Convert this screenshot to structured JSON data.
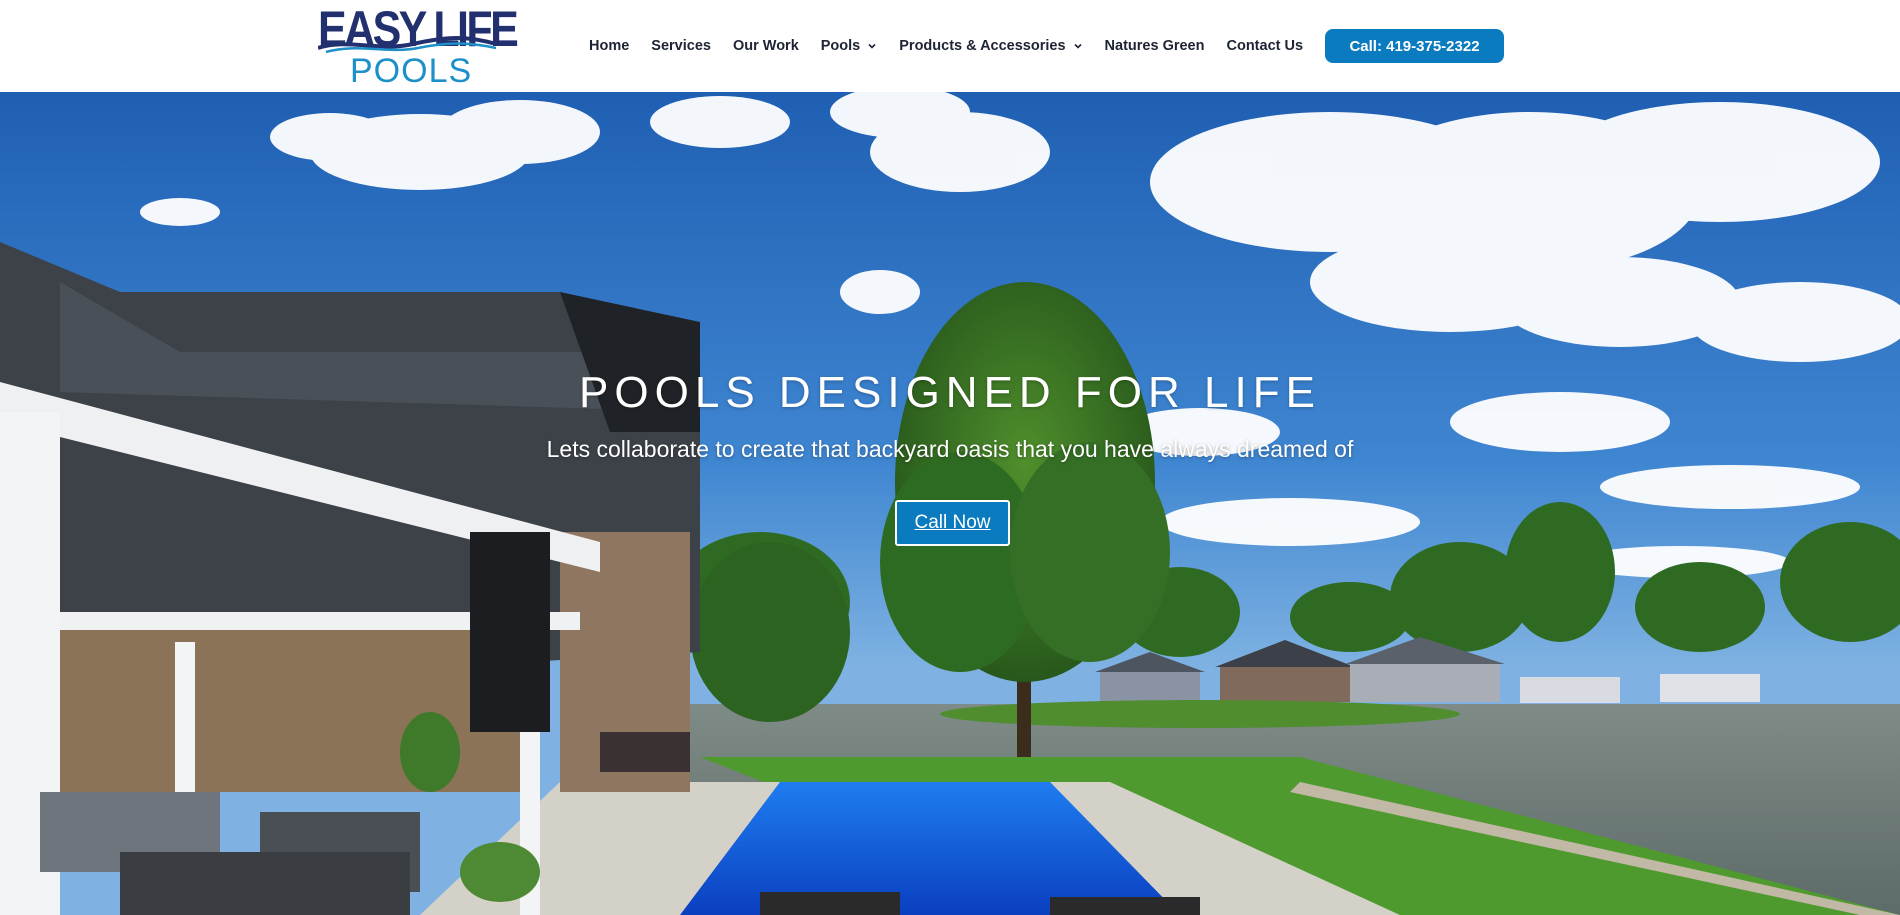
{
  "logo": {
    "line1": "EASY LIFE",
    "line2": "POOLS",
    "colors": {
      "primary": "#23306f",
      "secondary": "#1d8fc9"
    }
  },
  "nav": {
    "items": [
      {
        "label": "Home"
      },
      {
        "label": "Services"
      },
      {
        "label": "Our Work"
      },
      {
        "label": "Pools",
        "icon": "chevron-down-icon"
      },
      {
        "label": "Products & Accessories",
        "icon": "chevron-down-icon"
      },
      {
        "label": "Natures Green"
      },
      {
        "label": "Contact Us"
      }
    ]
  },
  "header": {
    "call_label": "Call: 419-375-2322",
    "accent": "#0a7bbf"
  },
  "hero": {
    "title": "POOLS DESIGNED FOR LIFE",
    "subtitle": "Lets collaborate to create that backyard oasis that you have always dreamed of",
    "cta_label": "Call Now",
    "background": "backyard-pool-lake-scene"
  }
}
